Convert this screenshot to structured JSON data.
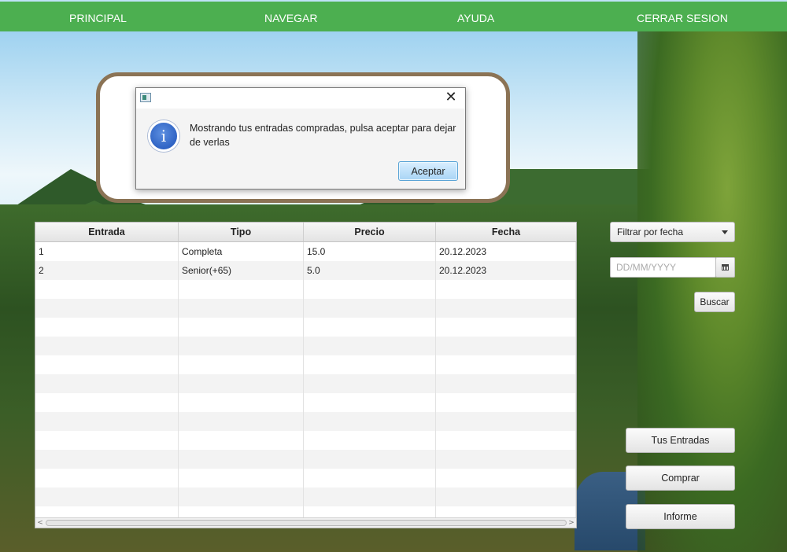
{
  "menu": {
    "items": [
      "PRINCIPAL",
      "NAVEGAR",
      "AYUDA",
      "CERRAR SESION"
    ],
    "bar_color": "#4caf50"
  },
  "dialog": {
    "message": "Mostrando tus entradas compradas, pulsa aceptar para dejar de verlas",
    "ok_label": "Aceptar",
    "icon": "info-icon"
  },
  "table": {
    "columns": [
      "Entrada",
      "Tipo",
      "Precio",
      "Fecha"
    ],
    "rows": [
      [
        "1",
        "Completa",
        "15.0",
        "20.12.2023"
      ],
      [
        "2",
        "Senior(+65)",
        "5.0",
        "20.12.2023"
      ]
    ]
  },
  "filter": {
    "combo_label": "Filtrar por fecha",
    "date_placeholder": "DD/MM/YYYY",
    "search_label": "Buscar"
  },
  "actions": {
    "tus_entradas": "Tus Entradas",
    "comprar": "Comprar",
    "informe": "Informe"
  }
}
